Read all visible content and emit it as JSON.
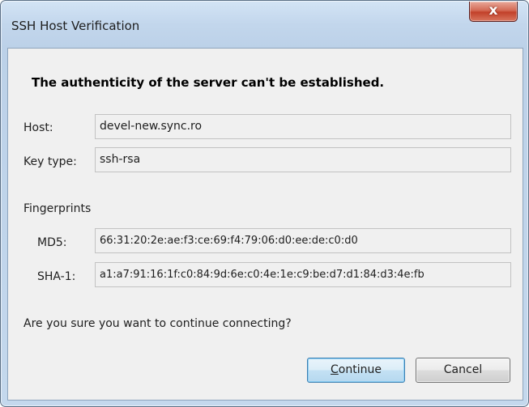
{
  "window": {
    "title": "SSH Host Verification",
    "close_glyph": "x"
  },
  "dialog": {
    "heading": "The authenticity of the server can't be established.",
    "host": {
      "label": "Host:",
      "value": "devel-new.sync.ro"
    },
    "key_type": {
      "label": "Key type:",
      "value": "ssh-rsa"
    },
    "fingerprints": {
      "section_label": "Fingerprints",
      "md5": {
        "label": "MD5:",
        "value": "66:31:20:2e:ae:f3:ce:69:f4:79:06:d0:ee:de:c0:d0"
      },
      "sha1": {
        "label": "SHA-1:",
        "value": "a1:a7:91:16:1f:c0:84:9d:6e:c0:4e:1e:c9:be:d7:d1:84:d3:4e:fb"
      }
    },
    "question": "Are you sure you want to continue connecting?",
    "buttons": {
      "continue_label": "Continue",
      "cancel_label": "Cancel"
    }
  },
  "colors": {
    "title_bar": "#c2d6ec",
    "close_button": "#c2412a",
    "client_background": "#f0f0f0",
    "default_button_border": "#3c7fb1"
  },
  "icons": {
    "close": "close-icon"
  }
}
